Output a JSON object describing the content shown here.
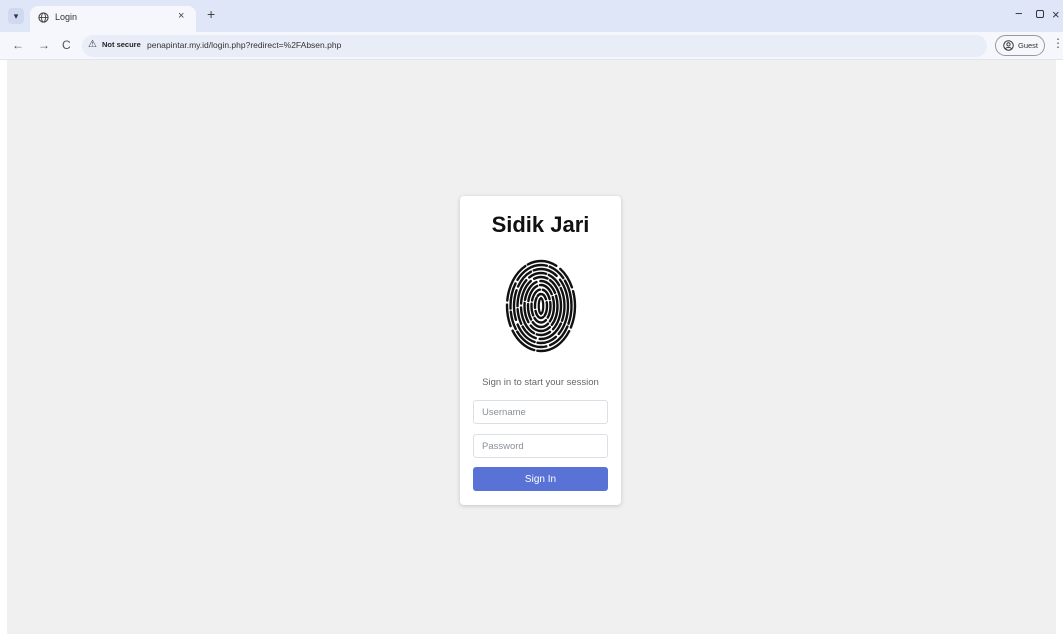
{
  "browser": {
    "tab": {
      "title": "Login",
      "close": "×"
    },
    "new_tab": "+",
    "nav": {
      "back": "←",
      "forward": "→",
      "reload": "C"
    },
    "address": {
      "security_label": "Not secure",
      "url": "penapintar.my.id/login.php?redirect=%2FAbsen.php"
    },
    "profile": {
      "label": "Guest"
    },
    "window": {
      "minimize": "−",
      "close": "×"
    },
    "menu": "⋮"
  },
  "login": {
    "title": "Sidik Jari",
    "subtitle": "Sign in to start your session",
    "username_placeholder": "Username",
    "password_placeholder": "Password",
    "submit_label": "Sign In"
  },
  "colors": {
    "accent": "#5872d6",
    "page_background": "#f0f0f0",
    "tabbar": "#dfe6f7"
  },
  "icons": [
    "tab-dropdown-icon",
    "globe-icon",
    "warning-icon",
    "fingerprint-icon",
    "user-circle-icon"
  ]
}
